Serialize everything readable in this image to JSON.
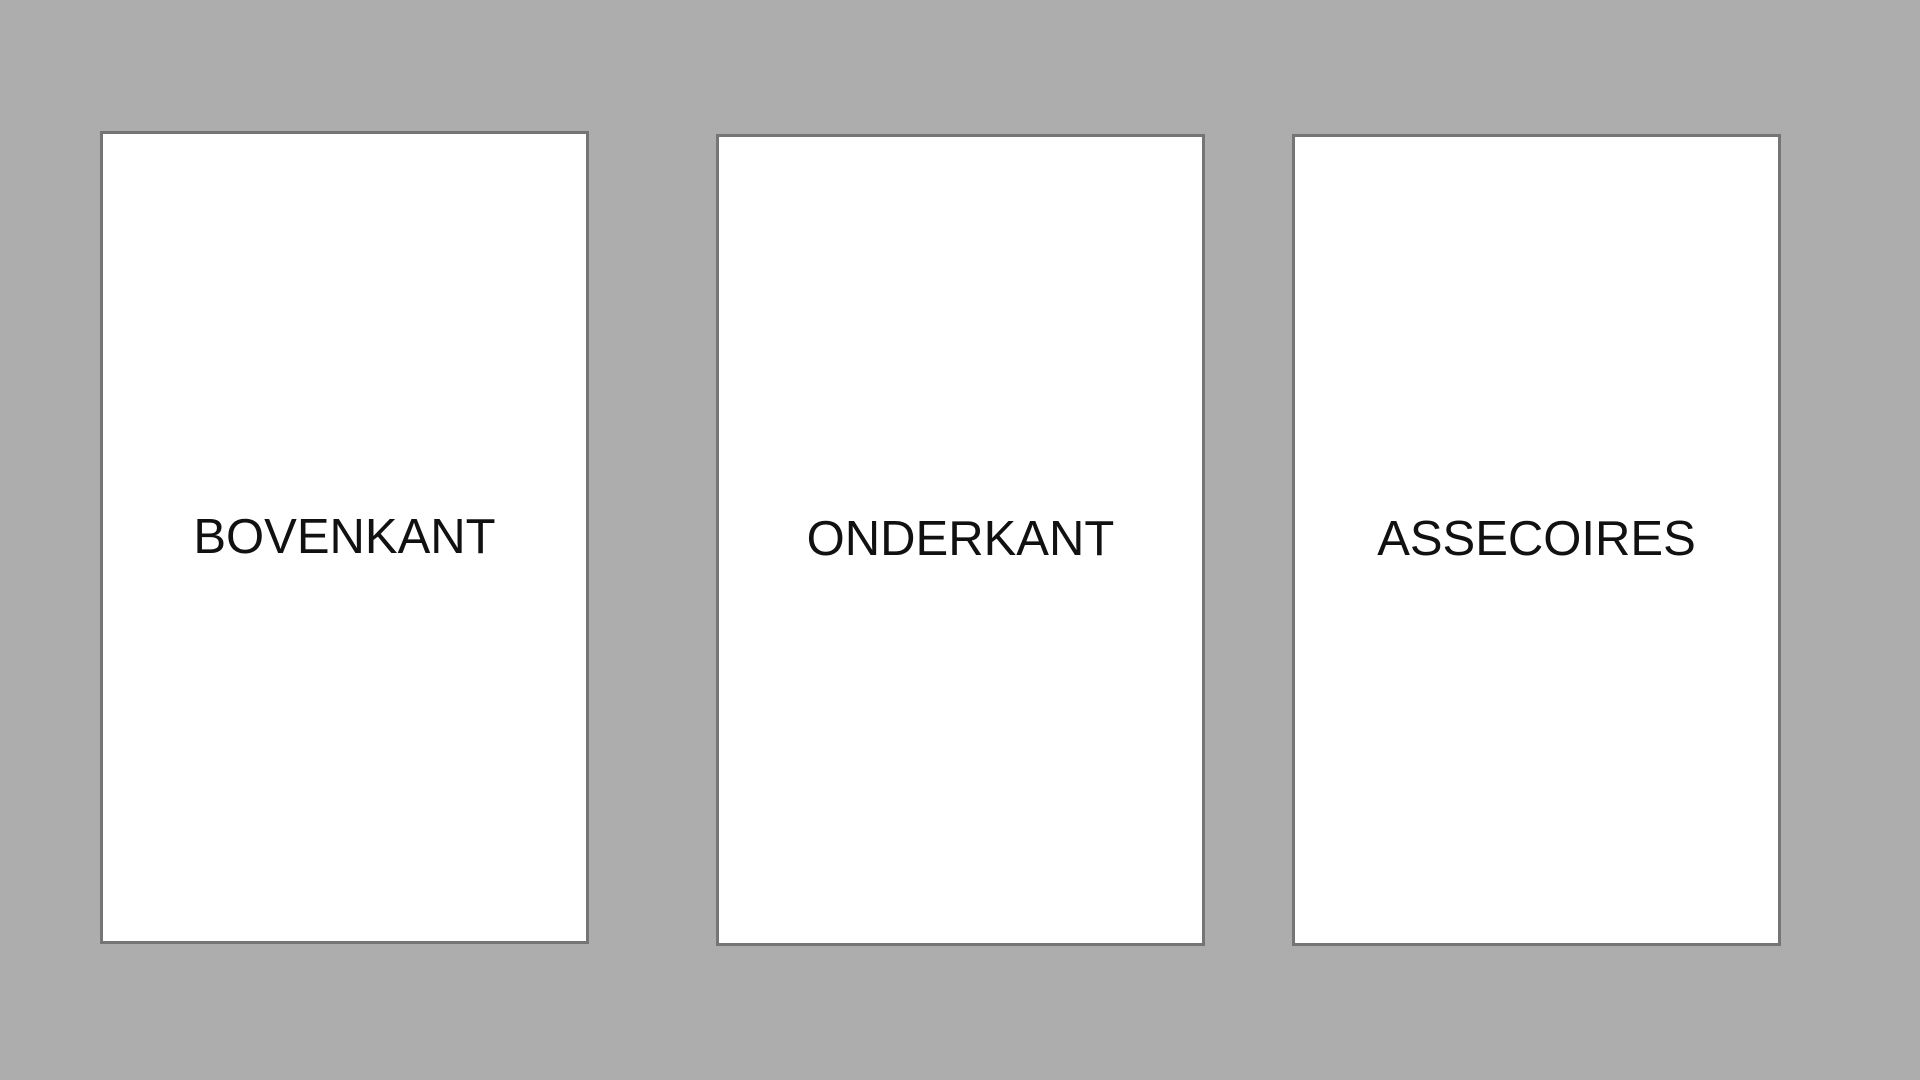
{
  "colors": {
    "background": "#adadad",
    "card_background": "#ffffff",
    "card_border": "#757575",
    "text": "#111111"
  },
  "categories": [
    {
      "label": "BOVENKANT"
    },
    {
      "label": "ONDERKANT"
    },
    {
      "label": "ASSECOIRES"
    }
  ]
}
